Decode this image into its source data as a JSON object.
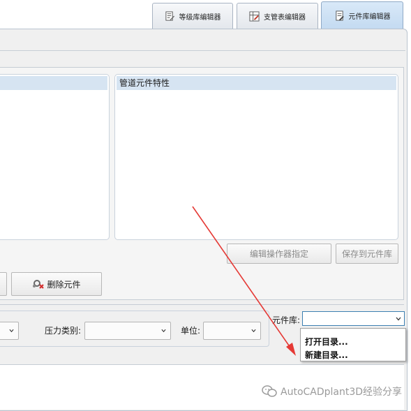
{
  "tabs": [
    {
      "label": "等级库编辑器",
      "icon": "spec-editor-icon",
      "active": false
    },
    {
      "label": "支管表编辑器",
      "icon": "branch-table-icon",
      "active": false
    },
    {
      "label": "元件库编辑器",
      "icon": "component-library-icon",
      "active": true
    }
  ],
  "properties_panel": {
    "header": "管道元件特性"
  },
  "buttons": {
    "edit_operator": "编辑操作器指定",
    "save_to_library": "保存到元件库",
    "delete_component": "删除元件"
  },
  "filters": {
    "pressure_class_label": "压力类别:",
    "unit_label": "单位:",
    "library_label": "元件库:",
    "pressure_class_value": "",
    "unit_value": "",
    "library_value": ""
  },
  "library_dropdown": {
    "options": [
      "打开目录...",
      "新建目录..."
    ]
  },
  "watermark": {
    "text": "AutoCADplant3D经验分享",
    "icon": "wechat-icon"
  },
  "colors": {
    "accent": "#d6e4f2",
    "arrow": "#e53935",
    "focus": "#3c7fb1"
  }
}
